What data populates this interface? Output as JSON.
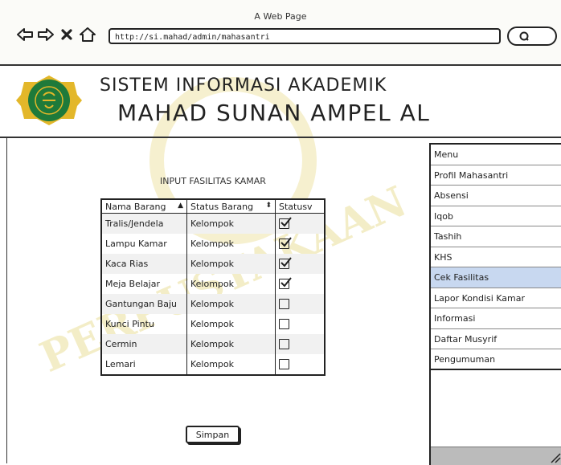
{
  "window": {
    "title": "A Web Page"
  },
  "browser": {
    "url": "http://si.mahad/admin/mahasantri"
  },
  "header": {
    "line1": "SISTEM INFORMASI AKADEMIK",
    "line2": "MAHAD SUNAN AMPEL AL"
  },
  "form": {
    "title": "INPUT FASILITAS KAMAR",
    "columns": [
      "Nama Barang",
      "Status Barang",
      "Statusv"
    ],
    "rows": [
      {
        "nama": "Tralis/Jendela",
        "status": "Kelompok",
        "checked": true
      },
      {
        "nama": "Lampu Kamar",
        "status": "Kelompok",
        "checked": true
      },
      {
        "nama": "Kaca Rias",
        "status": "Kelompok",
        "checked": true
      },
      {
        "nama": "Meja Belajar",
        "status": "Kelompok",
        "checked": true
      },
      {
        "nama": "Gantungan Baju",
        "status": "Kelompok",
        "checked": false
      },
      {
        "nama": "Kunci Pintu",
        "status": "Kelompok",
        "checked": false
      },
      {
        "nama": "Cermin",
        "status": "Kelompok",
        "checked": false
      },
      {
        "nama": "Lemari",
        "status": "Kelompok",
        "checked": false
      }
    ],
    "save_label": "Simpan"
  },
  "sidebar": {
    "items": [
      {
        "label": "Menu"
      },
      {
        "label": "Profil Mahasantri"
      },
      {
        "label": "Absensi"
      },
      {
        "label": "Iqob"
      },
      {
        "label": "Tashih"
      },
      {
        "label": "KHS"
      },
      {
        "label": "Cek Fasilitas",
        "selected": true
      },
      {
        "label": "Lapor Kondisi Kamar"
      },
      {
        "label": "Informasi"
      },
      {
        "label": "Daftar Musyrif"
      },
      {
        "label": "Pengumuman"
      }
    ]
  },
  "watermark": "PERPUSTAKAAN",
  "icons": [
    "back-arrow-icon",
    "forward-arrow-icon",
    "close-x-icon",
    "home-icon",
    "search-icon",
    "sort-up-icon",
    "sort-both-icon",
    "checkbox-icon"
  ],
  "colors": {
    "selected_menu": "#c8d8f0",
    "logo_green": "#1e7a3a",
    "logo_gold": "#e3b72a"
  }
}
